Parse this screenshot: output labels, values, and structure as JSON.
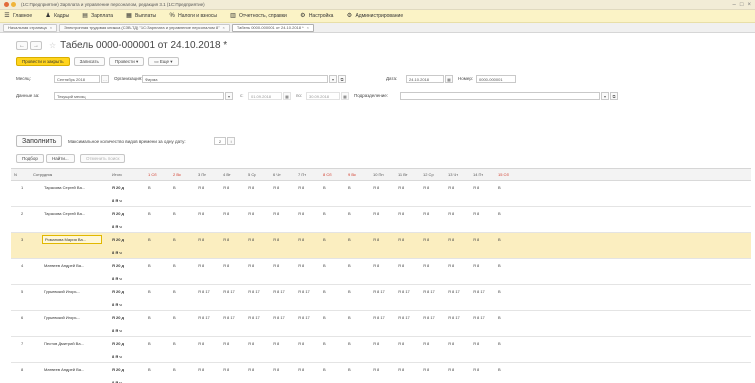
{
  "titlebar": {
    "title": "(1С:Предприятие) Зарплата и управление персоналом, редакция 3.1 (1С:Предприятие)"
  },
  "main_menu": [
    {
      "label": "Главное",
      "icon": "hamburger-icon",
      "glyph": "☰"
    },
    {
      "label": "Кадры",
      "icon": "people-icon",
      "glyph": "♟"
    },
    {
      "label": "Зарплата",
      "icon": "salary-icon",
      "glyph": "▤"
    },
    {
      "label": "Выплаты",
      "icon": "payments-icon",
      "glyph": "▦"
    },
    {
      "label": "Налоги и взносы",
      "icon": "percent-icon",
      "glyph": "%"
    },
    {
      "label": "Отчетность, справки",
      "icon": "reports-icon",
      "glyph": "▥"
    },
    {
      "label": "Настройка",
      "icon": "wrench-icon",
      "glyph": "⚙"
    },
    {
      "label": "Администрирование",
      "icon": "gear-icon",
      "glyph": "⚙"
    }
  ],
  "window_tabs": [
    {
      "label": "Начальная страница"
    },
    {
      "label": "Электронная трудовая книжка (СЗВ-ТД) \"1С:Зарплата и управление персоналом 8\""
    },
    {
      "label": "Табель 0000-000001 от 24.10.2018 *"
    }
  ],
  "form": {
    "title": "Табель 0000-000001 от 24.10.2018 *",
    "buttons": {
      "post_close": "Провести и закрыть",
      "save": "Записать",
      "post": "Провести",
      "more": "Еще"
    }
  },
  "fields": {
    "month_label": "Месяц:",
    "month_value": "Сентябрь 2018",
    "organization_label": "Организация:",
    "organization_value": "Фирма",
    "data_for_label": "Данные за:",
    "data_for_value": "Текущий месяц",
    "period_from": "01.09.2018",
    "period_to": "30.09.2018",
    "date_label": "Дата:",
    "date_value": "24.10.2018",
    "number_label": "Номер:",
    "number_value": "0000-000001",
    "department_label": "Подразделение:",
    "department_value": ""
  },
  "fill": {
    "button": "Заполнить",
    "max_hours_label": "Максимальное количество видов времени за одну дату:",
    "max_hours_value": "2"
  },
  "grid_toolbar": {
    "select": "Подбор",
    "find": "Найти...",
    "cancel_search": "Отменить поиск"
  },
  "grid": {
    "headers": {
      "n": "N",
      "employee": "Сотрудник",
      "total": "Итого",
      "days": [
        "1 Сб",
        "2 Вс",
        "3 Пн",
        "4 Вт",
        "5 Ср",
        "6 Чт",
        "7 Пт",
        "8 Сб",
        "9 Вс",
        "10 Пн",
        "11 Вт",
        "12 Ср",
        "13 Чт",
        "14 Пт",
        "15 Сб"
      ]
    },
    "rows": [
      {
        "n": "1",
        "employee": "Тарасова Сергей Ва...",
        "total1": "Я 20 д",
        "total2": "8 Я ч",
        "days": [
          "В",
          "В",
          "Я 8",
          "Я 8",
          "Я 8",
          "Я 8",
          "Я 8",
          "В",
          "В",
          "Я 8",
          "Я 8",
          "Я 8",
          "Я 8",
          "Я 8",
          "В"
        ]
      },
      {
        "n": "2",
        "employee": "Тарасова Сергей Ва...",
        "total1": "Я 20 д",
        "total2": "8 Я ч",
        "days": [
          "В",
          "В",
          "Я 8",
          "Я 8",
          "Я 8",
          "Я 8",
          "Я 8",
          "В",
          "В",
          "Я 8",
          "Я 8",
          "Я 8",
          "Я 8",
          "Я 8",
          "В"
        ]
      },
      {
        "n": "3",
        "employee": "Романова Мария Ва...",
        "total1": "Я 20 д",
        "total2": "8 Я ч",
        "days": [
          "В",
          "В",
          "Я 8",
          "Я 8",
          "Я 8",
          "Я 8",
          "Я 8",
          "В",
          "В",
          "Я 8",
          "Я 8",
          "Я 8",
          "Я 8",
          "Я 8",
          "В"
        ]
      },
      {
        "n": "4",
        "employee": "Матвеев Андрей Ва...",
        "total1": "Я 20 д",
        "total2": "8 Я ч",
        "days": [
          "В",
          "В",
          "Я 8",
          "Я 8",
          "Я 8",
          "Я 8",
          "Я 8",
          "В",
          "В",
          "Я 8",
          "Я 8",
          "Я 8",
          "Я 8",
          "Я 8",
          "В"
        ]
      },
      {
        "n": "5",
        "employee": "Гурьевский Игорь...",
        "total1": "Я 20 д",
        "total2": "8 Я ч",
        "days": [
          "В",
          "В",
          "Я 8 17",
          "Я 8 17",
          "Я 8 17",
          "Я 8 17",
          "Я 8 17",
          "В",
          "В",
          "Я 8 17",
          "Я 8 17",
          "Я 8 17",
          "Я 8 17",
          "Я 8 17",
          "В"
        ]
      },
      {
        "n": "6",
        "employee": "Гурьевский Игорь...",
        "total1": "Я 20 д",
        "total2": "8 Я ч",
        "days": [
          "В",
          "В",
          "Я 8 17",
          "Я 8 17",
          "Я 8 17",
          "Я 8 17",
          "Я 8 17",
          "В",
          "В",
          "Я 8 17",
          "Я 8 17",
          "Я 8 17",
          "Я 8 17",
          "Я 8 17",
          "В"
        ]
      },
      {
        "n": "7",
        "employee": "Пестов Дмитрий Ва...",
        "total1": "Я 20 д",
        "total2": "8 Я ч",
        "days": [
          "В",
          "В",
          "Я 8",
          "Я 8",
          "Я 8",
          "Я 8",
          "Я 8",
          "В",
          "В",
          "Я 8",
          "Я 8",
          "Я 8",
          "Я 8",
          "Я 8",
          "В"
        ]
      },
      {
        "n": "8",
        "employee": "Матвеев Андрей Ва...",
        "total1": "Я 20 д",
        "total2": "8 Я ч",
        "days": [
          "В",
          "В",
          "Я 8",
          "Я 8",
          "Я 8",
          "Я 8",
          "Я 8",
          "В",
          "В",
          "Я 8",
          "Я 8",
          "Я 8",
          "Я 8",
          "Я 8",
          "В"
        ]
      }
    ],
    "selected_row": 2
  }
}
